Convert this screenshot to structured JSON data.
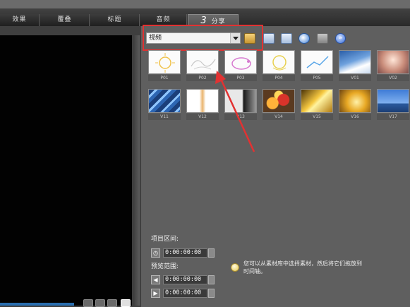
{
  "tabs": [
    {
      "label": "效果"
    },
    {
      "label": "覆叠"
    },
    {
      "label": "标题"
    },
    {
      "label": "音频"
    },
    {
      "num": "3",
      "label": "分享"
    }
  ],
  "library": {
    "category": "视频",
    "toolbar_icons": [
      "folder-icon",
      "import-icon",
      "list-view-icon",
      "sort-icon",
      "pages-icon",
      "expand-icon"
    ],
    "more_glyph": "»"
  },
  "thumbnails": [
    {
      "caption": "P01"
    },
    {
      "caption": "P02"
    },
    {
      "caption": "P03"
    },
    {
      "caption": "P04"
    },
    {
      "caption": "P05"
    },
    {
      "caption": "V01"
    },
    {
      "caption": "V02"
    },
    {
      "caption": "V11"
    },
    {
      "caption": "V12"
    },
    {
      "caption": "V13"
    },
    {
      "caption": "V14"
    },
    {
      "caption": "V15"
    },
    {
      "caption": "V16"
    },
    {
      "caption": "V17"
    }
  ],
  "project_range": {
    "label": "项目区间:",
    "duration": "0:00:00:00"
  },
  "preview_range": {
    "label": "预览范围:",
    "start": "0:00:00:00",
    "end": "0:00:00:00"
  },
  "tip": "您可以从素材库中选择素材，然后将它们拖放到时间轴。",
  "colors": {
    "accent_red": "#e23232",
    "panel": "#5f5f5f"
  }
}
